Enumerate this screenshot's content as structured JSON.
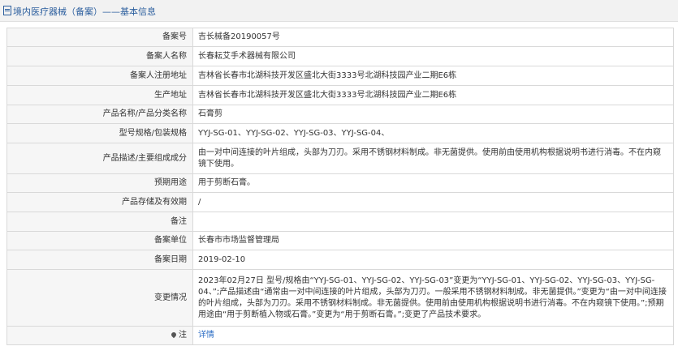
{
  "header": {
    "title": "境内医疗器械（备案）——基本信息"
  },
  "rows": [
    {
      "label": "备案号",
      "value": "吉长械备20190057号",
      "h": 23
    },
    {
      "label": "备案人名称",
      "value": "长春耘艾手术器械有限公司",
      "h": 24
    },
    {
      "label": "备案人注册地址",
      "value": "吉林省长春市北湖科技开发区盛北大街3333号北湖科技园产业二期E6栋",
      "h": 24
    },
    {
      "label": "生产地址",
      "value": "吉林省长春市北湖科技开发区盛北大街3333号北湖科技园产业二期E6栋",
      "h": 24
    },
    {
      "label": "产品名称/产品分类名称",
      "value": "石膏剪",
      "h": 23
    },
    {
      "label": "型号规格/包装规格",
      "value": "YYJ-SG-01、YYJ-SG-02、YYJ-SG-03、YYJ-SG-04、",
      "h": 24
    },
    {
      "label": "产品描述/主要组成成分",
      "value": "由一对中间连接的叶片组成，头部为刀刃。采用不锈钢材料制成。非无菌提供。使用前由使用机构根据说明书进行消毒。不在内窥镜下使用。",
      "h": 38
    },
    {
      "label": "预期用途",
      "value": "用于剪断石膏。",
      "h": 23
    },
    {
      "label": "产品存储及有效期",
      "value": "/",
      "h": 24
    },
    {
      "label": "备注",
      "value": "",
      "h": 24
    },
    {
      "label": "备案单位",
      "value": "长春市市场监督管理局",
      "h": 23
    },
    {
      "label": "备案日期",
      "value": "2019-02-10",
      "h": 24
    },
    {
      "label": "变更情况",
      "value": "2023年02月27日 型号/规格由“YYJ-SG-01、YYJ-SG-02、YYJ-SG-03”变更为“YYJ-SG-01、YYJ-SG-02、YYJ-SG-03、YYJ-SG-04、”;产品描述由“通常由一对中间连接的叶片组成，头部为刀刃。一般采用不锈钢材料制成。非无菌提供。”变更为“由一对中间连接的叶片组成，头部为刀刃。采用不锈钢材料制成。非无菌提供。使用前由使用机构根据说明书进行消毒。不在内窥镜下使用。”;预期用途由“用于剪断植入物或石膏。”变更为“用于剪断石膏。”;变更了产品技术要求。",
      "h": 70
    }
  ],
  "note_row": {
    "label": "注",
    "link": "详情",
    "icon": "location-pin-icon"
  },
  "colors": {
    "title": "#2b5e9e",
    "label_bg": "#f6f6f6",
    "border": "#d9d9d9",
    "link": "#2b6cc4"
  }
}
